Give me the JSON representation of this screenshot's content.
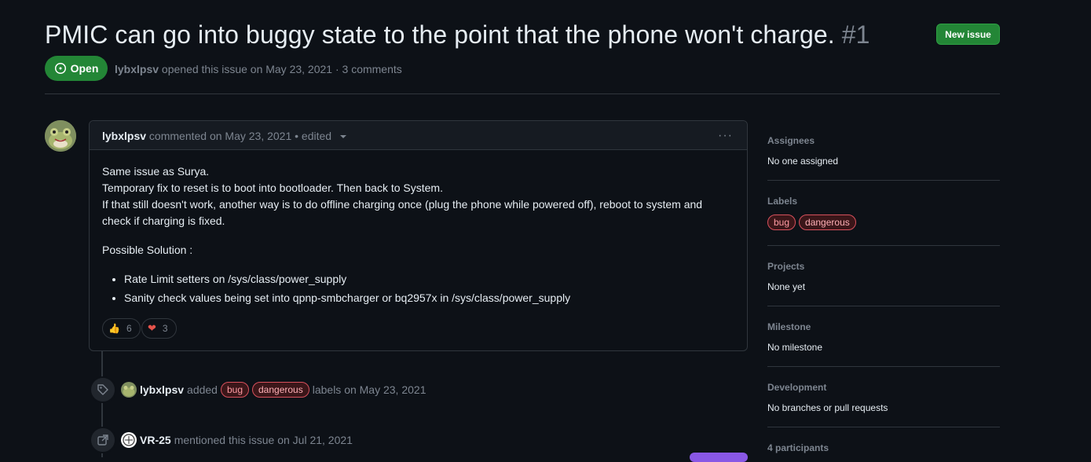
{
  "issue": {
    "title": "PMIC can go into buggy state to the point that the phone won't charge.",
    "number": "#1",
    "status": "Open",
    "author": "lybxlpsv",
    "meta_text": "opened this issue on May 23, 2021 · 3 comments"
  },
  "header": {
    "new_issue_label": "New issue"
  },
  "comment": {
    "author": "lybxlpsv",
    "meta": "commented on May 23, 2021 • edited",
    "paragraph1": [
      "Same issue as Surya.",
      "Temporary fix to reset is to boot into bootloader. Then back to System.",
      "If that still doesn't work, another way is to do offline charging once (plug the phone while powered off), reboot to system and check if charging is fixed."
    ],
    "paragraph2": "Possible Solution :",
    "bullets": [
      "Rate Limit setters on /sys/class/power_supply",
      "Sanity check values being set into qpnp-smbcharger or bq2957x in /sys/class/power_supply"
    ],
    "reactions": [
      {
        "emoji": "👍",
        "count": "6"
      },
      {
        "emoji": "❤",
        "count": "3"
      }
    ]
  },
  "timeline": [
    {
      "actor": "lybxlpsv",
      "action": "added",
      "labels": [
        "bug",
        "dangerous"
      ],
      "suffix": "labels on May 23, 2021"
    },
    {
      "actor": "VR-25",
      "action": "mentioned this issue on Jul 21, 2021"
    }
  ],
  "sidebar": {
    "assignees": {
      "heading": "Assignees",
      "value": "No one assigned"
    },
    "labels": {
      "heading": "Labels",
      "items": [
        "bug",
        "dangerous"
      ]
    },
    "projects": {
      "heading": "Projects",
      "value": "None yet"
    },
    "milestone": {
      "heading": "Milestone",
      "value": "No milestone"
    },
    "development": {
      "heading": "Development",
      "value": "No branches or pull requests"
    },
    "participants": {
      "heading": "4 participants"
    }
  },
  "colors": {
    "accent_green": "#238636",
    "label_red": "#d7505c",
    "background": "#0d1117"
  }
}
